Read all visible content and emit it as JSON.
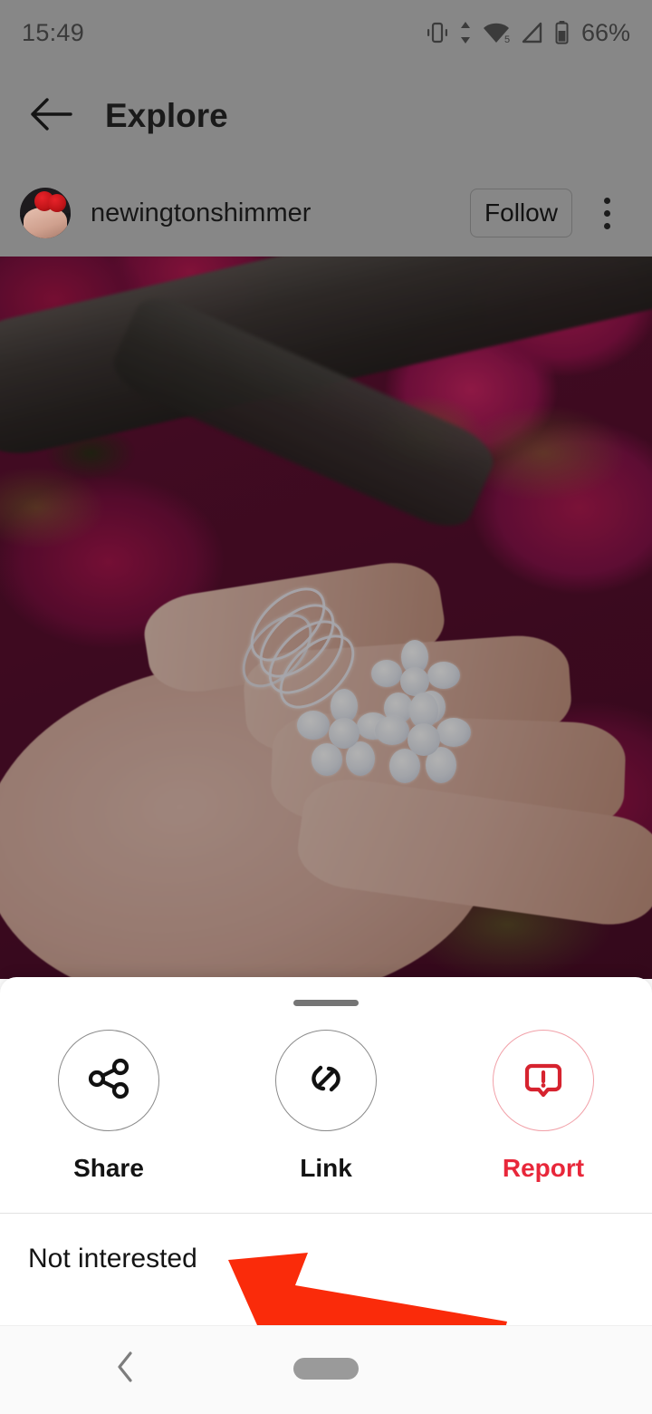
{
  "status_bar": {
    "time": "15:49",
    "battery_percent": "66%",
    "icons": [
      "vibrate-icon",
      "data-transfer-icon",
      "wifi-icon",
      "cellular-signal-icon",
      "battery-icon"
    ],
    "wifi_badge": "5"
  },
  "app_bar": {
    "back_icon": "arrow-left-icon",
    "title": "Explore"
  },
  "post_header": {
    "avatar_alt": "newingtonshimmer profile picture",
    "username": "newingtonshimmer",
    "follow_label": "Follow",
    "overflow_icon": "more-vertical-icon"
  },
  "post_image": {
    "alt": "Hand wearing stacked diamond rings and flower rings in front of pink crabapple blossoms"
  },
  "bottom_sheet": {
    "drag_handle": "drag-handle",
    "actions": [
      {
        "label": "Share",
        "icon": "share-icon",
        "danger": false
      },
      {
        "label": "Link",
        "icon": "link-icon",
        "danger": false
      },
      {
        "label": "Report",
        "icon": "report-icon",
        "danger": true
      }
    ],
    "list_items": [
      {
        "label": "Not interested"
      }
    ]
  },
  "annotation": {
    "type": "arrow",
    "color": "#fa2b0a",
    "points_to": "Not interested"
  },
  "nav_bar": {
    "back_icon": "chevron-left-icon",
    "home_icon": "home-pill-icon"
  },
  "colors": {
    "scrim_grey": "#878787",
    "danger_red": "#e8273a",
    "annotation_red": "#fa2b0a",
    "sheet_background": "#ffffff"
  }
}
